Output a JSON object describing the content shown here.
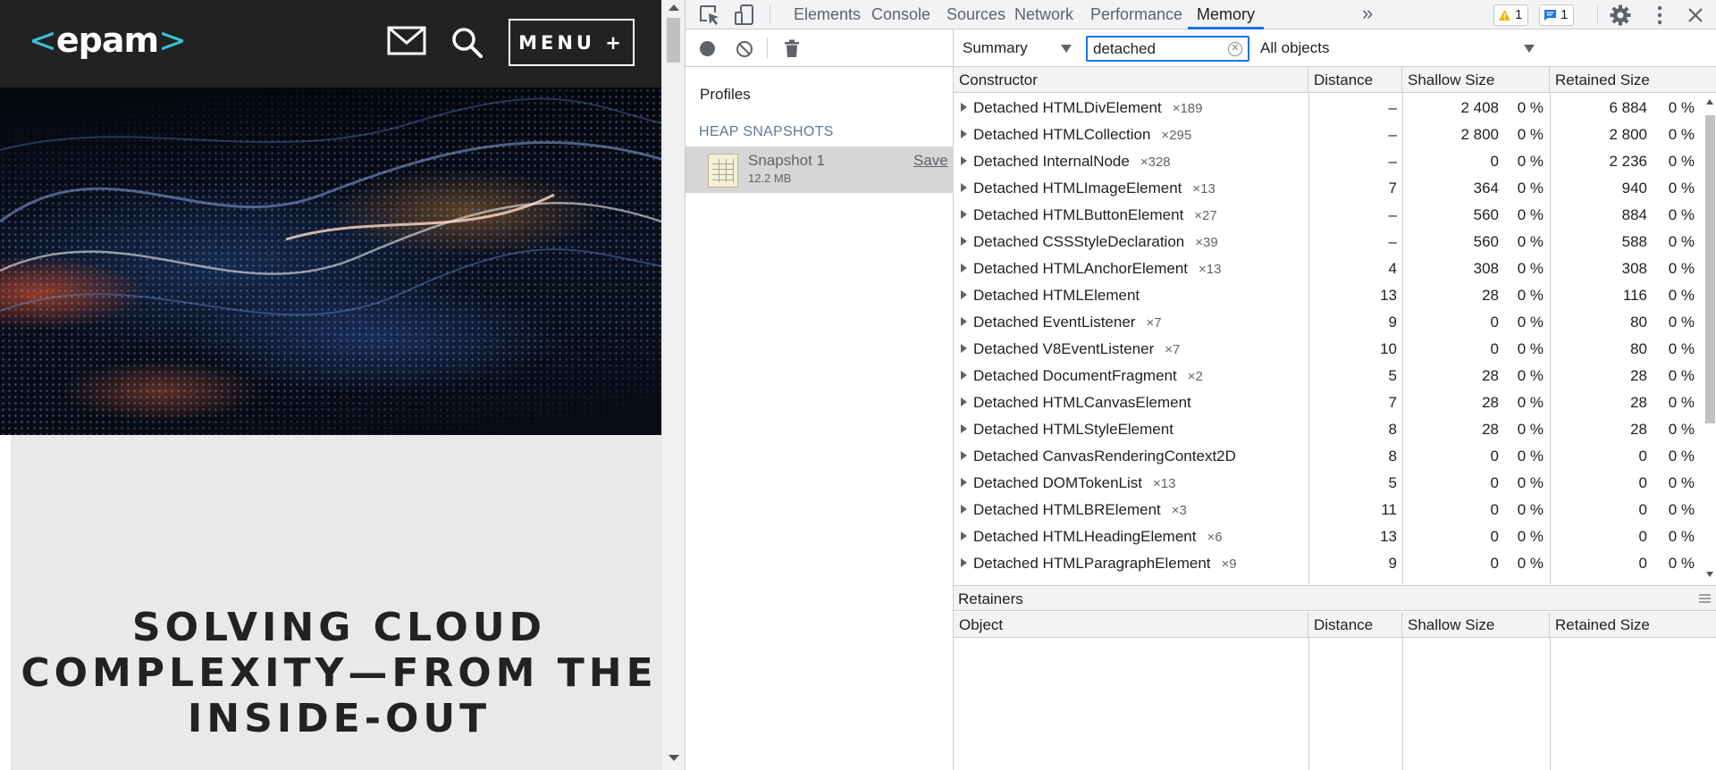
{
  "site": {
    "logo": {
      "left": "<",
      "text": "epam",
      "right": ">"
    },
    "menu_label": "MENU +",
    "headline": [
      "SOLVING CLOUD",
      "COMPLEXITY—FROM THE",
      "INSIDE-OUT"
    ]
  },
  "devtools": {
    "tabs": [
      "Elements",
      "Console",
      "Sources",
      "Network",
      "Performance",
      "Memory"
    ],
    "active_tab": "Memory",
    "more_tabs": "»",
    "warnings_count": "1",
    "messages_count": "1",
    "sidebar": {
      "profiles_label": "Profiles",
      "heap_section": "HEAP SNAPSHOTS",
      "snapshot": {
        "name": "Snapshot 1",
        "size": "12.2 MB",
        "save_label": "Save"
      }
    },
    "toolbar": {
      "view": "Summary",
      "filter_value": "detached",
      "objects": "All objects"
    },
    "columns": [
      "Constructor",
      "Distance",
      "Shallow Size",
      "Retained Size"
    ],
    "rows": [
      {
        "name": "Detached HTMLDivElement",
        "count": "×189",
        "distance": "–",
        "shallow": "2 408",
        "shallow_pct": "0 %",
        "retained": "6 884",
        "retained_pct": "0 %"
      },
      {
        "name": "Detached HTMLCollection",
        "count": "×295",
        "distance": "–",
        "shallow": "2 800",
        "shallow_pct": "0 %",
        "retained": "2 800",
        "retained_pct": "0 %"
      },
      {
        "name": "Detached InternalNode",
        "count": "×328",
        "distance": "–",
        "shallow": "0",
        "shallow_pct": "0 %",
        "retained": "2 236",
        "retained_pct": "0 %"
      },
      {
        "name": "Detached HTMLImageElement",
        "count": "×13",
        "distance": "7",
        "shallow": "364",
        "shallow_pct": "0 %",
        "retained": "940",
        "retained_pct": "0 %"
      },
      {
        "name": "Detached HTMLButtonElement",
        "count": "×27",
        "distance": "–",
        "shallow": "560",
        "shallow_pct": "0 %",
        "retained": "884",
        "retained_pct": "0 %"
      },
      {
        "name": "Detached CSSStyleDeclaration",
        "count": "×39",
        "distance": "–",
        "shallow": "560",
        "shallow_pct": "0 %",
        "retained": "588",
        "retained_pct": "0 %"
      },
      {
        "name": "Detached HTMLAnchorElement",
        "count": "×13",
        "distance": "4",
        "shallow": "308",
        "shallow_pct": "0 %",
        "retained": "308",
        "retained_pct": "0 %"
      },
      {
        "name": "Detached HTMLElement",
        "count": "",
        "distance": "13",
        "shallow": "28",
        "shallow_pct": "0 %",
        "retained": "116",
        "retained_pct": "0 %"
      },
      {
        "name": "Detached EventListener",
        "count": "×7",
        "distance": "9",
        "shallow": "0",
        "shallow_pct": "0 %",
        "retained": "80",
        "retained_pct": "0 %"
      },
      {
        "name": "Detached V8EventListener",
        "count": "×7",
        "distance": "10",
        "shallow": "0",
        "shallow_pct": "0 %",
        "retained": "80",
        "retained_pct": "0 %"
      },
      {
        "name": "Detached DocumentFragment",
        "count": "×2",
        "distance": "5",
        "shallow": "28",
        "shallow_pct": "0 %",
        "retained": "28",
        "retained_pct": "0 %"
      },
      {
        "name": "Detached HTMLCanvasElement",
        "count": "",
        "distance": "7",
        "shallow": "28",
        "shallow_pct": "0 %",
        "retained": "28",
        "retained_pct": "0 %"
      },
      {
        "name": "Detached HTMLStyleElement",
        "count": "",
        "distance": "8",
        "shallow": "28",
        "shallow_pct": "0 %",
        "retained": "28",
        "retained_pct": "0 %"
      },
      {
        "name": "Detached CanvasRenderingContext2D",
        "count": "",
        "distance": "8",
        "shallow": "0",
        "shallow_pct": "0 %",
        "retained": "0",
        "retained_pct": "0 %"
      },
      {
        "name": "Detached DOMTokenList",
        "count": "×13",
        "distance": "5",
        "shallow": "0",
        "shallow_pct": "0 %",
        "retained": "0",
        "retained_pct": "0 %"
      },
      {
        "name": "Detached HTMLBRElement",
        "count": "×3",
        "distance": "11",
        "shallow": "0",
        "shallow_pct": "0 %",
        "retained": "0",
        "retained_pct": "0 %"
      },
      {
        "name": "Detached HTMLHeadingElement",
        "count": "×6",
        "distance": "13",
        "shallow": "0",
        "shallow_pct": "0 %",
        "retained": "0",
        "retained_pct": "0 %"
      },
      {
        "name": "Detached HTMLParagraphElement",
        "count": "×9",
        "distance": "9",
        "shallow": "0",
        "shallow_pct": "0 %",
        "retained": "0",
        "retained_pct": "0 %"
      }
    ],
    "retainers": {
      "title": "Retainers",
      "columns": [
        "Object",
        "Distance",
        "Shallow Size",
        "Retained Size"
      ]
    },
    "colors": {
      "accent": "#1a73e8",
      "warning": "#f2b600"
    }
  }
}
